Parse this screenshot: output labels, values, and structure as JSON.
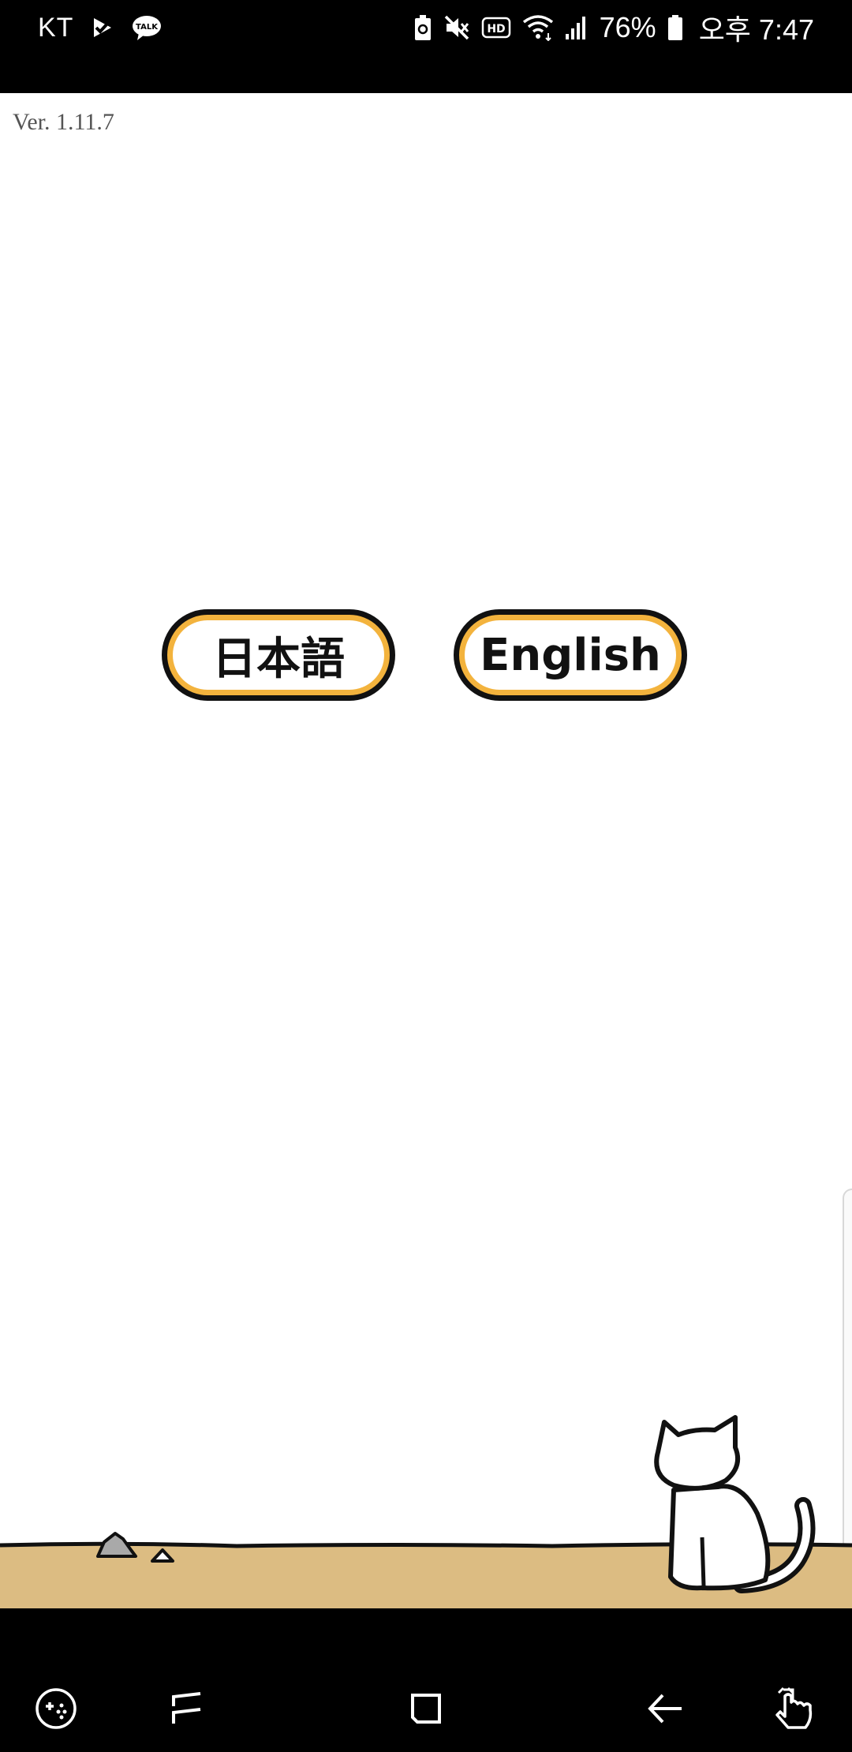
{
  "status_bar": {
    "carrier": "KT",
    "battery_percent": "76%",
    "time": "오후 7:47",
    "icons": [
      "check-notification-icon",
      "kakaotalk-icon",
      "battery-saver-icon",
      "mute-icon",
      "hd-icon",
      "wifi-icon",
      "signal-icon",
      "battery-icon"
    ],
    "talk_label": "TALK",
    "hd_label": "HD"
  },
  "app": {
    "version": "Ver. 1.11.7",
    "buttons": {
      "japanese": "日本語",
      "english": "English"
    },
    "colors": {
      "button_border": "#f3b33d",
      "ground": "#dcbc82",
      "background": "#ffffff"
    }
  },
  "nav_bar": {
    "icons": [
      "game-tools-icon",
      "recent-apps-icon",
      "home-icon",
      "back-icon",
      "touch-assist-icon"
    ]
  }
}
